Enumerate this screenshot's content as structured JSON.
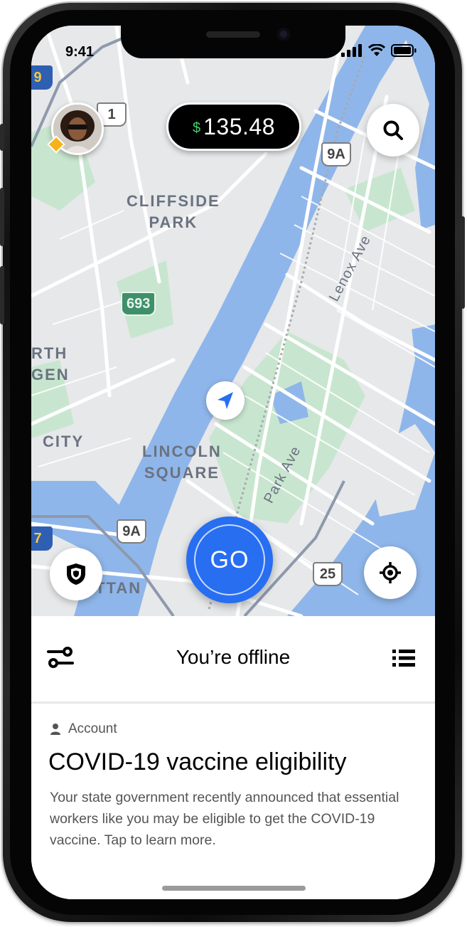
{
  "status_bar": {
    "time": "9:41"
  },
  "earnings": {
    "currency_symbol": "$",
    "amount": "135.48"
  },
  "map": {
    "area_labels": [
      {
        "line1": "CLIFFSIDE",
        "line2": "PARK"
      },
      {
        "line1": "RTH",
        "line2": "GEN"
      },
      {
        "line1": "CITY",
        "line2": ""
      },
      {
        "line1": "LINCOLN",
        "line2": "SQUARE"
      },
      {
        "line1": "HATTAN",
        "line2": ""
      }
    ],
    "streets": [
      "Lenox Ave",
      "Park Ave"
    ],
    "route_shields": {
      "s1": "1",
      "s9a_top": "9A",
      "s693": "693",
      "s9a_bottom": "9A",
      "s25": "25",
      "s9_edge": "9",
      "s7_edge": "7"
    }
  },
  "go_button": {
    "label": "GO"
  },
  "sheet": {
    "status_title": "You’re offline",
    "card": {
      "category": "Account",
      "title": "COVID-19 vaccine eligibility",
      "body": "Your state government recently announced that essential workers like you may be eligible to get the COVID-19 vaccine. Tap to learn more."
    }
  },
  "colors": {
    "go_blue": "#276ef1",
    "earnings_green": "#3ecf6e",
    "map_water": "#8fb6ea",
    "map_land": "#e6e8ea",
    "map_park": "#c8e6cf"
  },
  "icons": [
    "signal-icon",
    "wifi-icon",
    "battery-icon",
    "search-icon",
    "shield-icon",
    "locate-icon",
    "navigation-arrow-icon",
    "preferences-icon",
    "list-icon",
    "person-icon"
  ]
}
